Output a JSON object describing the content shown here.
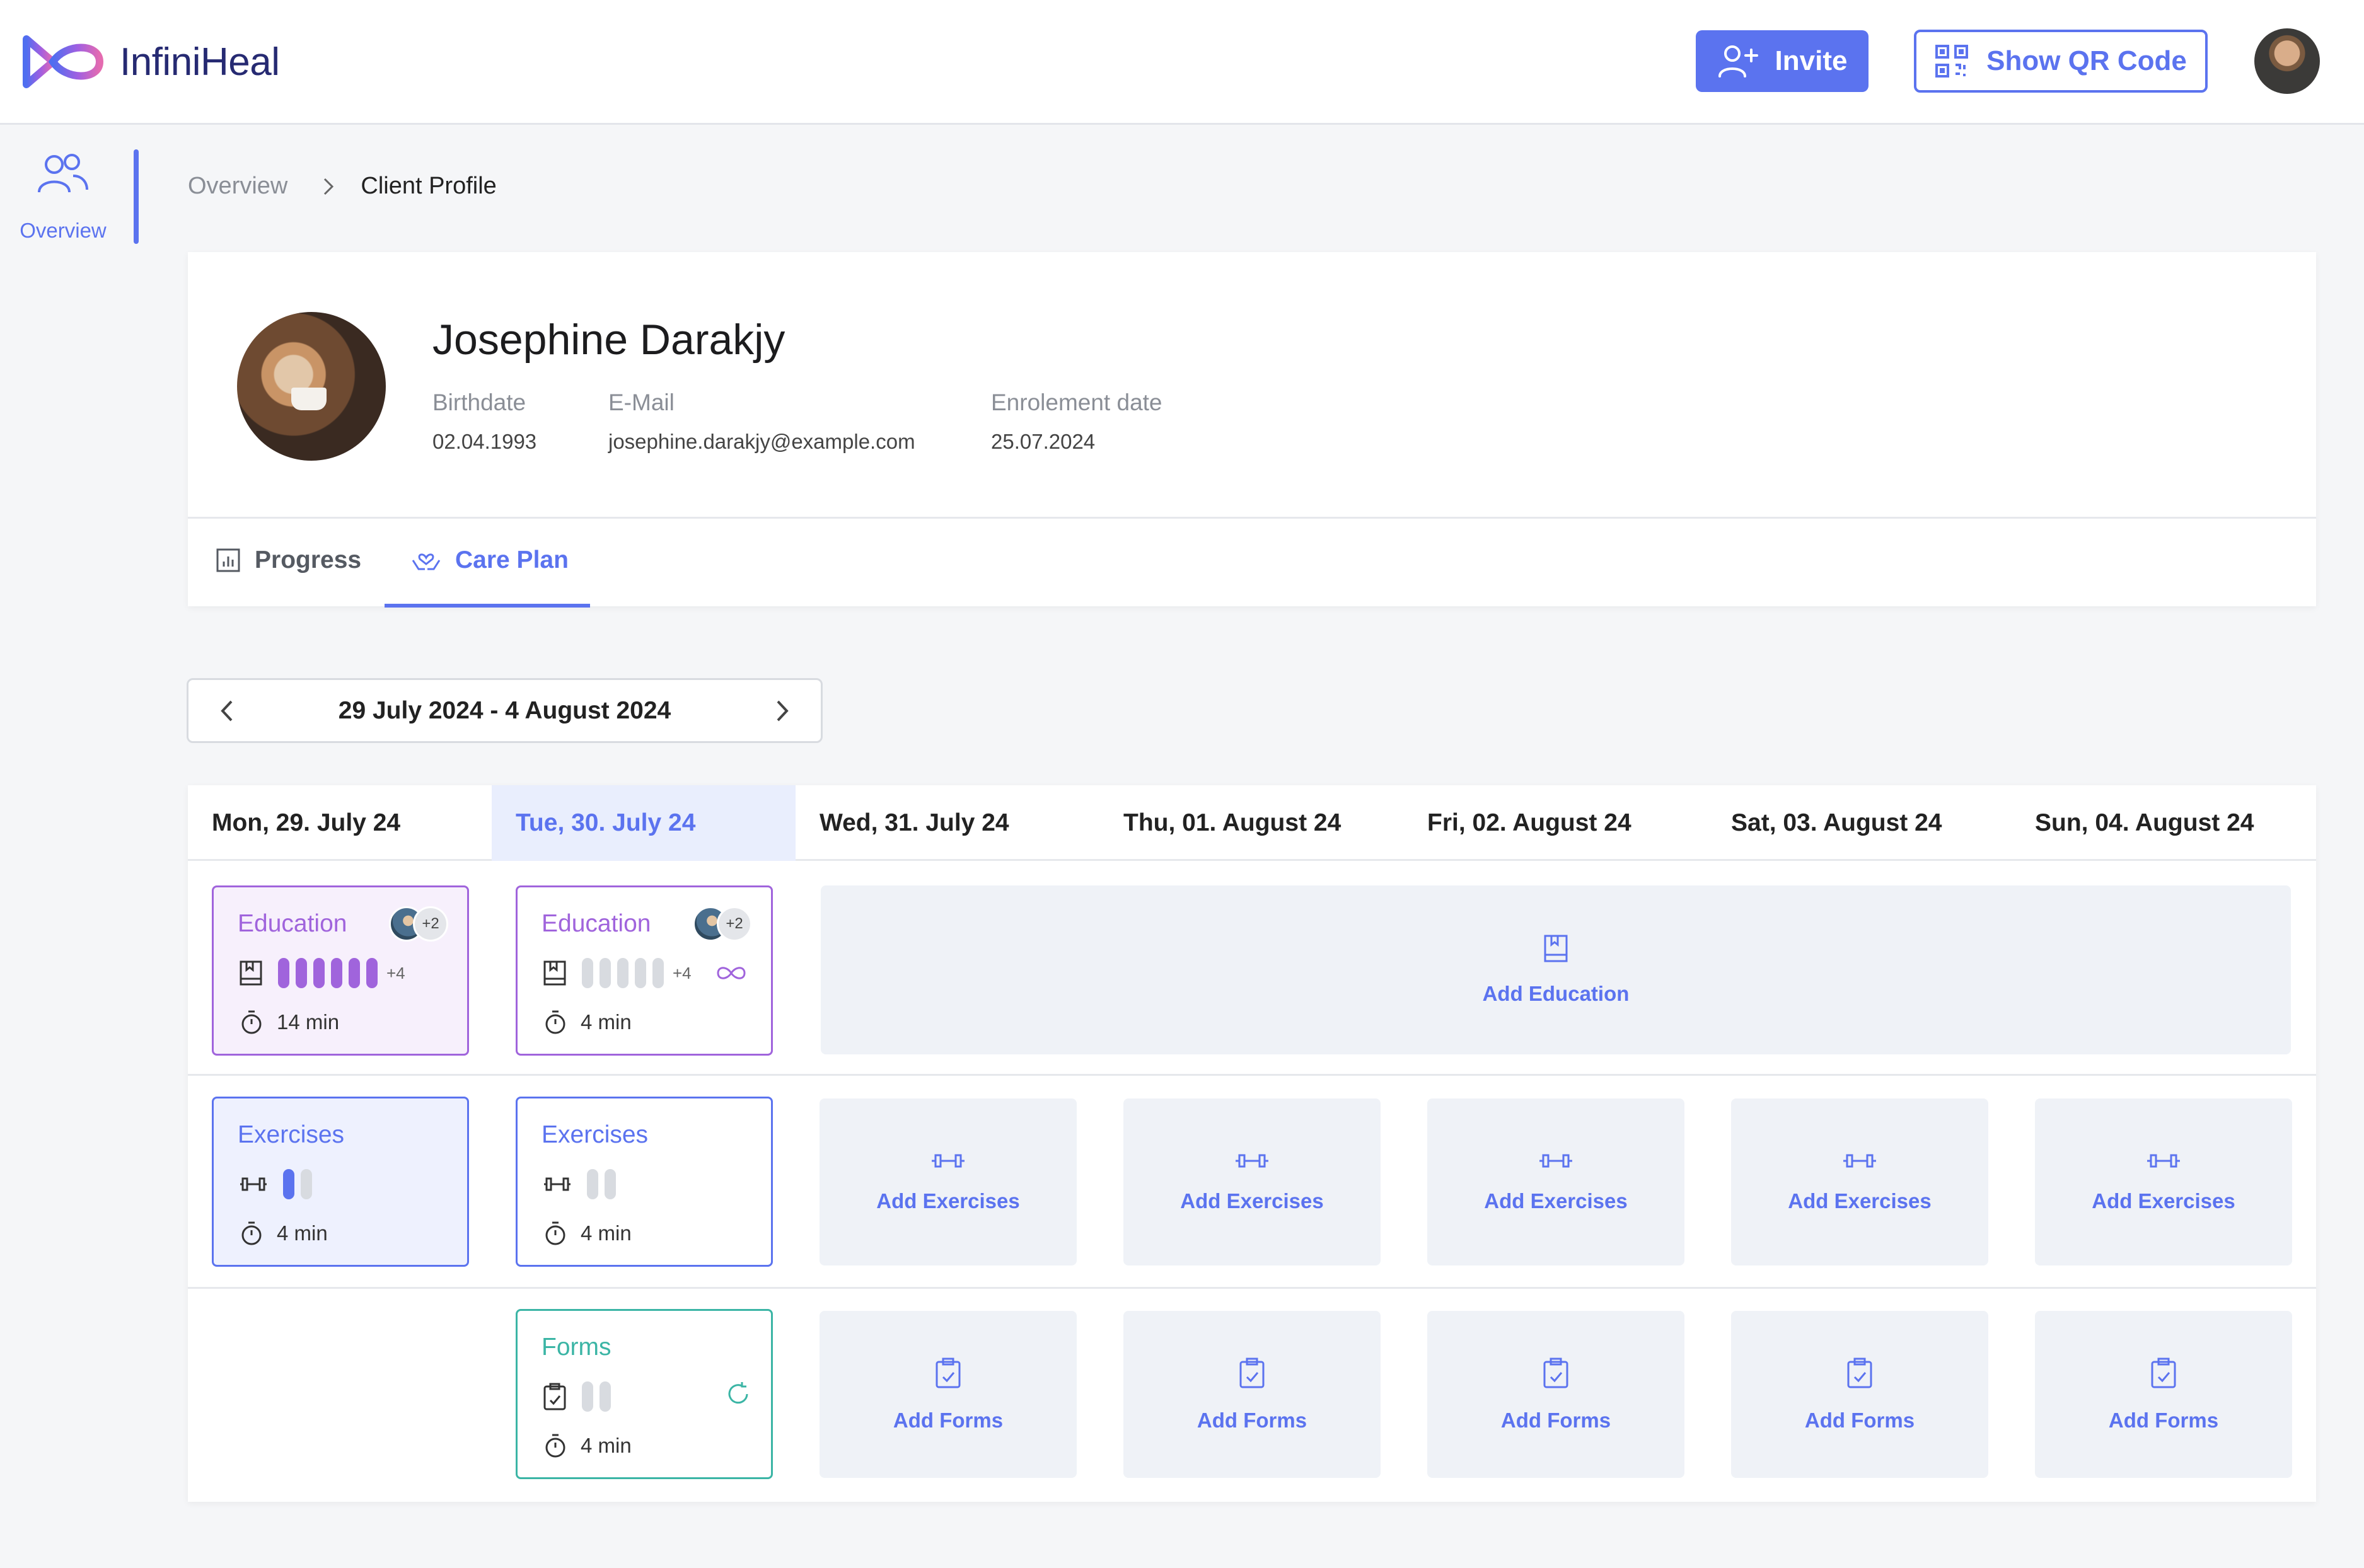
{
  "app": {
    "name": "InfiniHeal"
  },
  "header": {
    "invite_label": "Invite",
    "qr_label": "Show QR Code"
  },
  "sidebar": {
    "items": [
      {
        "label": "Overview",
        "icon": "users-icon"
      }
    ]
  },
  "breadcrumb": {
    "items": [
      "Overview",
      "Client Profile"
    ]
  },
  "client": {
    "name": "Josephine Darakjy",
    "birthdate_label": "Birthdate",
    "birthdate": "02.04.1993",
    "email_label": "E-Mail",
    "email": "josephine.darakjy@example.com",
    "enrolment_label": "Enrolement date",
    "enrolment": "25.07.2024"
  },
  "tabs": [
    {
      "label": "Progress",
      "icon": "bar-chart-icon"
    },
    {
      "label": "Care Plan",
      "icon": "care-hands-icon",
      "active": true
    }
  ],
  "week": {
    "label": "29 July 2024 - 4 August 2024"
  },
  "days": [
    {
      "label": "Mon, 29. July 24"
    },
    {
      "label": "Tue, 30. July 24",
      "today": true
    },
    {
      "label": "Wed, 31. July 24"
    },
    {
      "label": "Thu, 01. August 24"
    },
    {
      "label": "Fri, 02. August 24"
    },
    {
      "label": "Sat, 03. August 24"
    },
    {
      "label": "Sun, 04. August 24"
    }
  ],
  "cards": {
    "mon_education": {
      "title": "Education",
      "avatars_more": "+2",
      "items_more": "+4",
      "duration": "14 min",
      "completed": 6,
      "total": 6
    },
    "tue_education": {
      "title": "Education",
      "avatars_more": "+2",
      "items_more": "+4",
      "duration": "4 min",
      "completed": 0,
      "total": 5,
      "repeat": "infinity-icon"
    },
    "mon_exercises": {
      "title": "Exercises",
      "duration": "4 min",
      "completed": 1,
      "total": 2
    },
    "tue_exercises": {
      "title": "Exercises",
      "duration": "4 min",
      "completed": 0,
      "total": 2
    },
    "tue_forms": {
      "title": "Forms",
      "duration": "4 min",
      "completed": 0,
      "total": 2,
      "repeat": "refresh-icon"
    }
  },
  "add": {
    "education": "Add Education",
    "exercises": "Add Exercises",
    "forms": "Add Forms"
  },
  "colors": {
    "primary": "#5b73ef",
    "education": "#a064dc",
    "forms": "#3bb5a5",
    "today_bg": "#e9eefd",
    "add_bg": "#eff2f7"
  }
}
